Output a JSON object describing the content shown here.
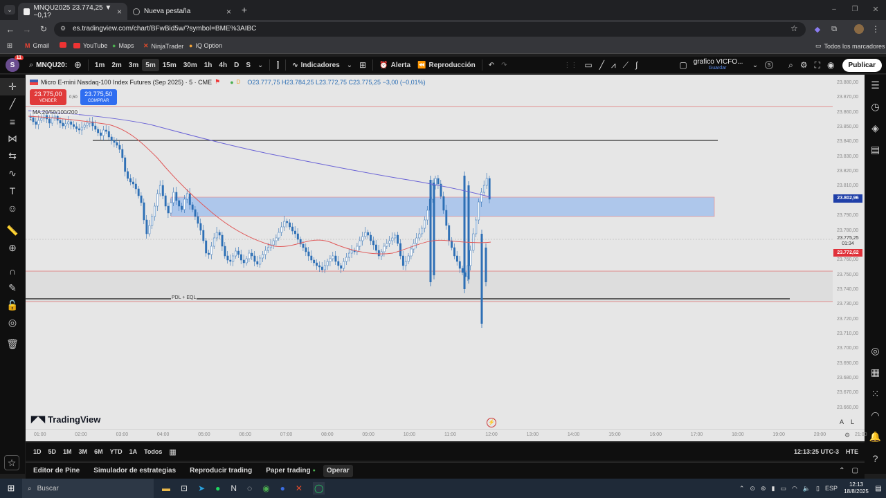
{
  "browser": {
    "tabs": [
      {
        "title": "MNQU2025 23.774,25 ▼ −0,1?"
      },
      {
        "title": "Nueva pestaña"
      }
    ],
    "url": "es.tradingview.com/chart/BFwBid5w/?symbol=BME%3AIBC",
    "bookmarks": [
      "Gmail",
      "YouTube",
      "Maps",
      "NinjaTrader",
      "IQ Option"
    ],
    "all_bookmarks": "Todos los marcadores"
  },
  "toolbar": {
    "symbol": "MNQU20:",
    "timeframes": [
      "1m",
      "2m",
      "3m",
      "5m",
      "15m",
      "30m",
      "1h",
      "4h",
      "D",
      "S"
    ],
    "selected_tf": "5m",
    "indicators": "Indicadores",
    "alert": "Alerta",
    "replay": "Reproducción",
    "layout_name": "grafico VICFO...",
    "layout_sub": "Guardar",
    "layout_badge": "S",
    "publish": "Publicar",
    "avatar_badge": "11"
  },
  "legend": {
    "title": "Micro E-mini Nasdaq-100 Index Futures (Sep 2025) · 5 · CME",
    "ohlc": "O23.777,75  H23.784,25  L23.772,75  C23.775,25  −3,00 (−0,01%)",
    "sell_price": "23.775,00",
    "sell_label": "VENDER",
    "spread": "0,50",
    "buy_price": "23.775,50",
    "buy_label": "COMPRAR",
    "ma_label": "MA 20/50/100/200",
    "badge_d": "D"
  },
  "price_axis": {
    "labels": [
      "23.880,00",
      "23.870,00",
      "23.860,00",
      "23.850,00",
      "23.840,00",
      "23.830,00",
      "23.820,00",
      "23.810,00",
      "23.790,00",
      "23.780,00",
      "23.760,00",
      "23.750,00",
      "23.740,00",
      "23.730,00",
      "23.720,00",
      "23.710,00",
      "23.700,00",
      "23.690,00",
      "23.680,00",
      "23.670,00",
      "23.660,00"
    ],
    "tag_zone": "23.802,96",
    "tag_current": "23.775,25",
    "tag_countdown": "01:34",
    "tag_ma": "23.772,62"
  },
  "annotations": {
    "pdl": "PDL + EQL"
  },
  "time_axis": {
    "labels": [
      "01:00",
      "02:00",
      "03:00",
      "04:00",
      "05:00",
      "06:00",
      "07:00",
      "08:00",
      "09:00",
      "10:00",
      "11:00",
      "12:00",
      "13:00",
      "14:00",
      "15:00",
      "16:00",
      "17:00",
      "18:00",
      "19:00",
      "20:00",
      "21:00"
    ]
  },
  "brand": "TradingView",
  "axis_mode": {
    "a": "A",
    "l": "L"
  },
  "range_bar": {
    "ranges": [
      "1D",
      "5D",
      "1M",
      "3M",
      "6M",
      "YTD",
      "1A",
      "Todos"
    ],
    "clock": "12:13:25 UTC-3",
    "session": "HTE"
  },
  "bottom_tabs": [
    "Editor de Pine",
    "Simulador de estrategias",
    "Reproducir trading",
    "Paper trading",
    "Operar"
  ],
  "taskbar": {
    "search": "Buscar",
    "lang": "ESP",
    "time": "12:13",
    "date": "18/8/2025"
  },
  "colors": {
    "zone_fill": "#a8c4ec",
    "ma_red": "#e05a5a",
    "ma_blue": "#6a63d6",
    "candle": "#2d6fb5",
    "sell": "#e03a3a",
    "buy": "#2f6df0"
  }
}
